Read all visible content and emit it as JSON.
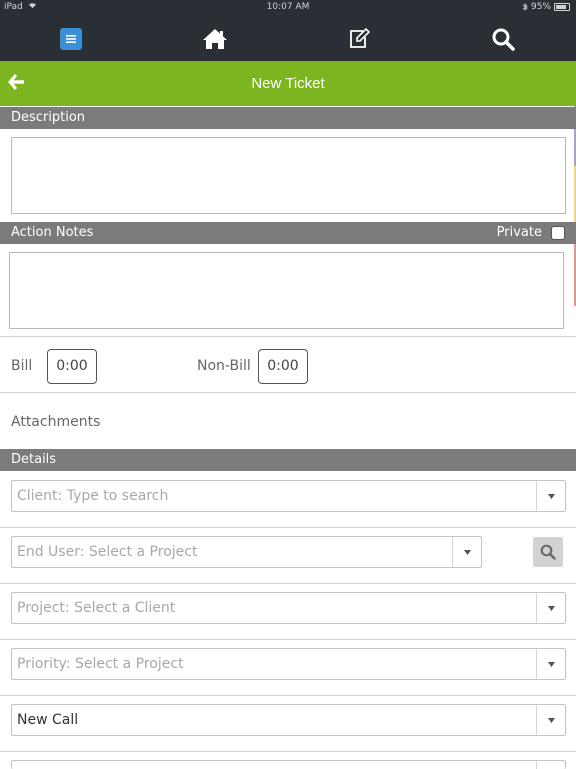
{
  "statusbar": {
    "device": "iPad",
    "time": "10:07 AM",
    "battery": "95%"
  },
  "navbar": {
    "icons": [
      "menu-icon",
      "home-icon",
      "edit-icon",
      "search-icon"
    ],
    "menu_color": "#3a8fd6"
  },
  "titlebar": {
    "title": "New Ticket",
    "color": "#7cb51f"
  },
  "description": {
    "label": "Description",
    "value": ""
  },
  "action_notes": {
    "label": "Action Notes",
    "private_label": "Private",
    "value": ""
  },
  "time": {
    "bill_label": "Bill",
    "bill_value": "0:00",
    "nonbill_label": "Non-Bill",
    "nonbill_value": "0:00"
  },
  "attachments": {
    "label": "Attachments"
  },
  "details": {
    "label": "Details",
    "client": {
      "placeholder": "Client: Type to search"
    },
    "end_user": {
      "placeholder": "End User: Select a Project"
    },
    "project": {
      "placeholder": "Project: Select a Client"
    },
    "priority": {
      "placeholder": "Priority: Select a Project"
    },
    "type": {
      "value": "New Call"
    }
  }
}
